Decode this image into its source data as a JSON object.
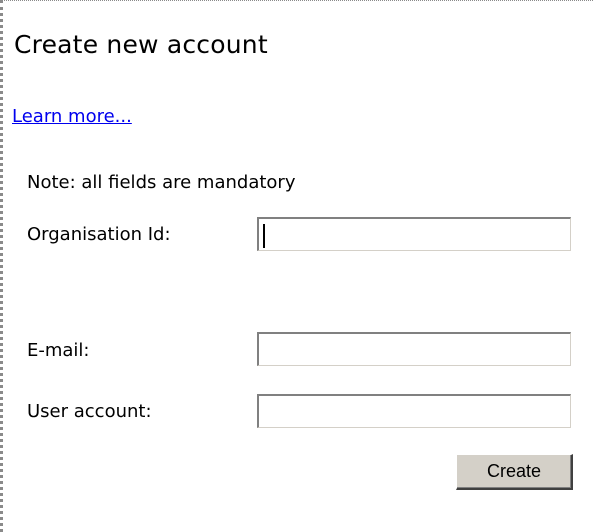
{
  "page": {
    "title": "Create new account",
    "learn_more_link": "Learn more...",
    "note": "Note: all fields are mandatory"
  },
  "form": {
    "organisation_id": {
      "label": "Organisation Id:",
      "value": ""
    },
    "email": {
      "label": "E-mail:",
      "value": ""
    },
    "user_account": {
      "label": "User account:",
      "value": ""
    },
    "submit_label": "Create"
  },
  "colors": {
    "link": "#0000ee",
    "button_face": "#d4d0c8"
  }
}
